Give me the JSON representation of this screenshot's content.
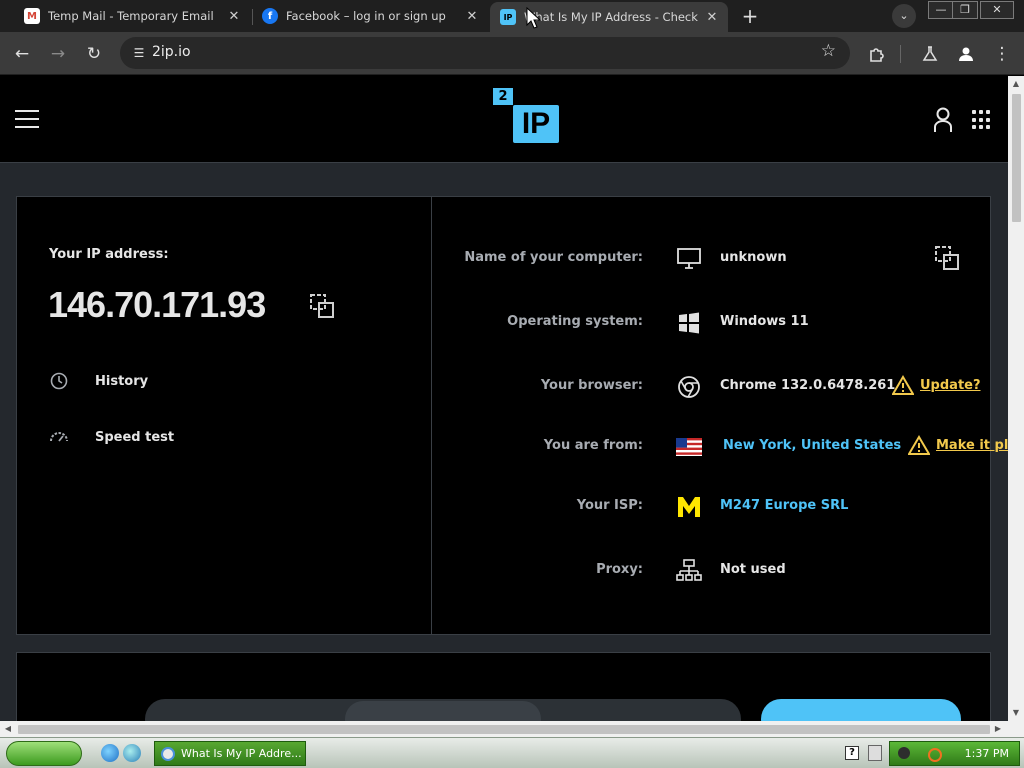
{
  "browser": {
    "tabs": [
      {
        "title": "Temp Mail - Temporary Email",
        "active": false
      },
      {
        "title": "Facebook – log in or sign up",
        "active": false
      },
      {
        "title": "What Is My IP Address - Check your",
        "active": true
      }
    ],
    "new_tab": "+",
    "tab_menu": "⌄",
    "close_glyph": "✕",
    "window_controls": {
      "minimize": "—",
      "maximize": "❐",
      "close": "✕"
    },
    "address": "2ip.io",
    "icons": [
      "back-icon",
      "forward-icon",
      "reload-icon",
      "tune-icon",
      "star-icon",
      "extensions-icon",
      "labs-icon",
      "profile-icon",
      "menu-icon"
    ]
  },
  "site": {
    "logo_small": "2",
    "logo_big": "IP",
    "ip_label": "Your IP address:",
    "ip_value": "146.70.171.93",
    "links": [
      {
        "label": "History",
        "icon": "history-icon"
      },
      {
        "label": "Speed test",
        "icon": "speedometer-icon"
      }
    ],
    "details": [
      {
        "label": "Name of your computer:",
        "value": "unknown",
        "icon": "monitor-icon"
      },
      {
        "label": "Operating system:",
        "value": "Windows 11",
        "icon": "windows-icon"
      },
      {
        "label": "Your browser:",
        "value": "Chrome 132.0.6478.261",
        "icon": "chrome-icon",
        "warning": "Update?"
      },
      {
        "label": "You are from:",
        "value": "New York, United States",
        "icon": "us-flag-icon",
        "warning": "Make it pla"
      },
      {
        "label": "Your ISP:",
        "value": "M247 Europe SRL",
        "icon": "isp-logo-icon"
      },
      {
        "label": "Proxy:",
        "value": "Not used",
        "icon": "network-icon"
      }
    ]
  },
  "taskbar": {
    "task_title": "What Is My IP Addre...",
    "help": "?",
    "clock": "1:37 PM"
  },
  "colors": {
    "accent": "#4fc3f7",
    "warning": "#f2c94c",
    "page_bg": "#24282d",
    "card_bg": "#000000"
  }
}
